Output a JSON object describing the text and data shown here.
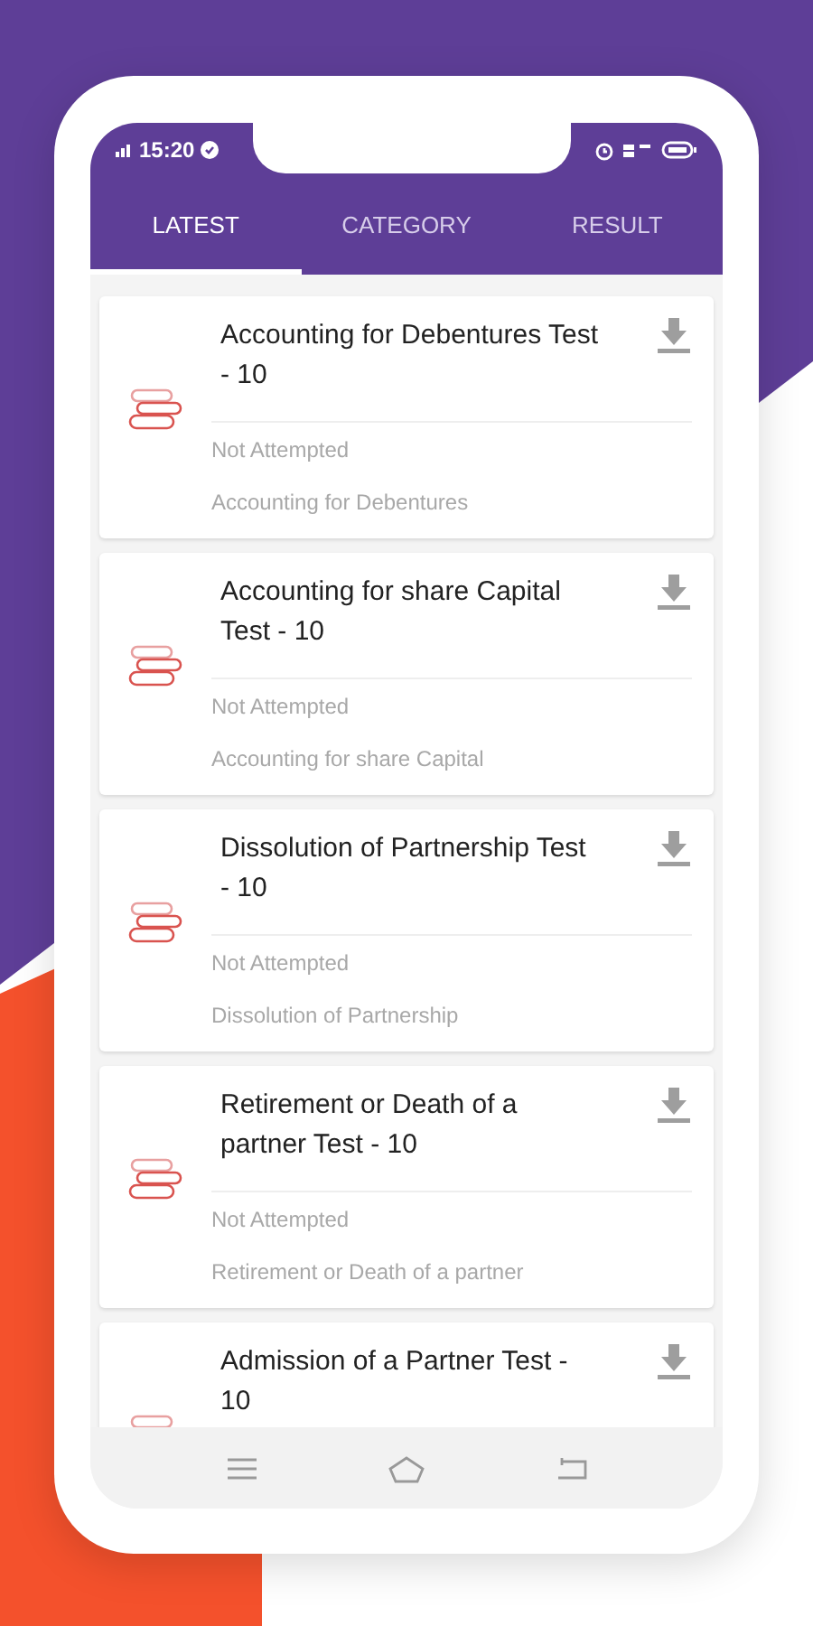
{
  "status_bar": {
    "time": "15:20"
  },
  "tabs": [
    {
      "label": "LATEST",
      "selected": true
    },
    {
      "label": "CATEGORY",
      "selected": false
    },
    {
      "label": "RESULT",
      "selected": false
    }
  ],
  "tests": [
    {
      "title": "Accounting for Debentures Test - 10",
      "status": "Not Attempted",
      "subject": "Accounting for Debentures"
    },
    {
      "title": "Accounting for share Capital Test - 10",
      "status": "Not Attempted",
      "subject": "Accounting for share Capital"
    },
    {
      "title": "Dissolution of Partnership Test - 10",
      "status": "Not Attempted",
      "subject": "Dissolution of Partnership"
    },
    {
      "title": "Retirement or Death of a partner Test - 10",
      "status": "Not Attempted",
      "subject": "Retirement or Death of a partner"
    },
    {
      "title": "Admission of a Partner Test - 10"
    }
  ]
}
